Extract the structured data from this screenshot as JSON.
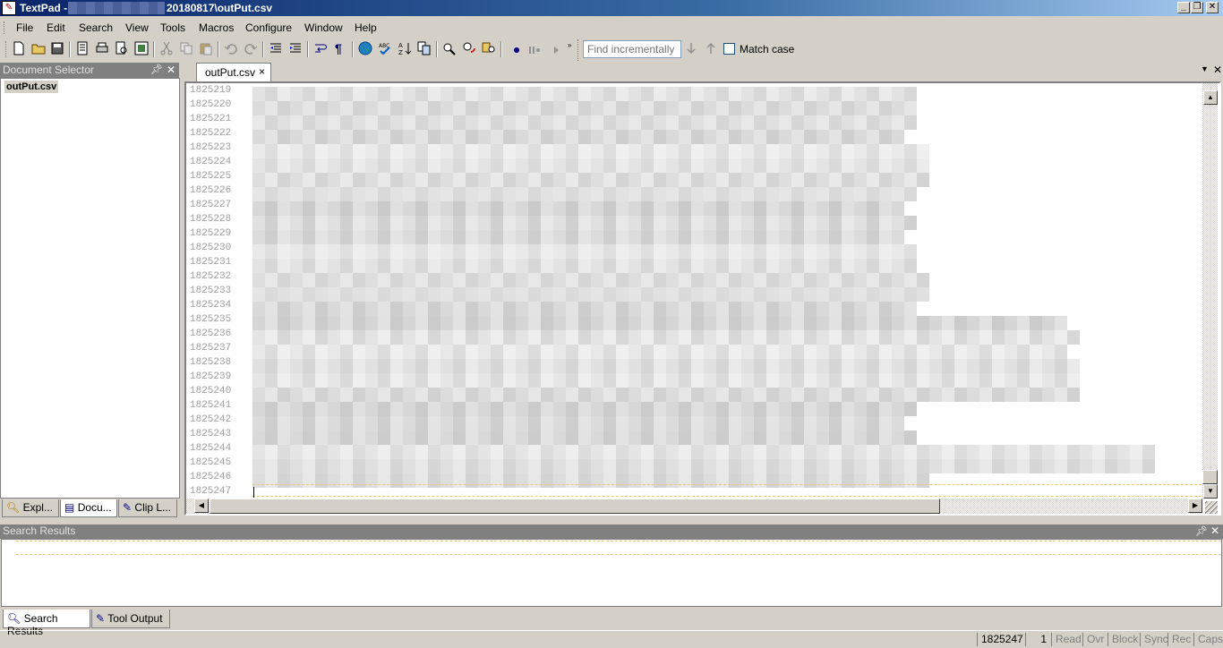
{
  "window": {
    "app_name": "TextPad -",
    "title_path": "20180817\\outPut.csv",
    "min_label": "_",
    "restore_label": "❐",
    "close_label": "✕"
  },
  "menu": [
    "File",
    "Edit",
    "Search",
    "View",
    "Tools",
    "Macros",
    "Configure",
    "Window",
    "Help"
  ],
  "toolbar": {
    "find_placeholder": "Find incrementally",
    "match_case_label": "Match case"
  },
  "doc_selector": {
    "title": "Document Selector",
    "items": [
      "outPut.csv"
    ],
    "tabs": [
      "Expl...",
      "Docu...",
      "Clip L..."
    ]
  },
  "editor": {
    "tab_label": "outPut.csv",
    "tab_close": "×",
    "line_numbers": [
      "1825219",
      "1825220",
      "1825221",
      "1825222",
      "1825223",
      "1825224",
      "1825225",
      "1825226",
      "1825227",
      "1825228",
      "1825229",
      "1825230",
      "1825231",
      "1825232",
      "1825233",
      "1825234",
      "1825235",
      "1825236",
      "1825237",
      "1825238",
      "1825239",
      "1825240",
      "1825241",
      "1825242",
      "1825243",
      "1825244",
      "1825245",
      "1825246",
      "1825247"
    ]
  },
  "search_results": {
    "title": "Search Results",
    "tabs": [
      "Search Results",
      "Tool Output"
    ]
  },
  "status": {
    "line": "1825247",
    "column": "1",
    "flags": [
      "Read",
      "Ovr",
      "Block",
      "Sync",
      "Rec",
      "Caps"
    ]
  }
}
